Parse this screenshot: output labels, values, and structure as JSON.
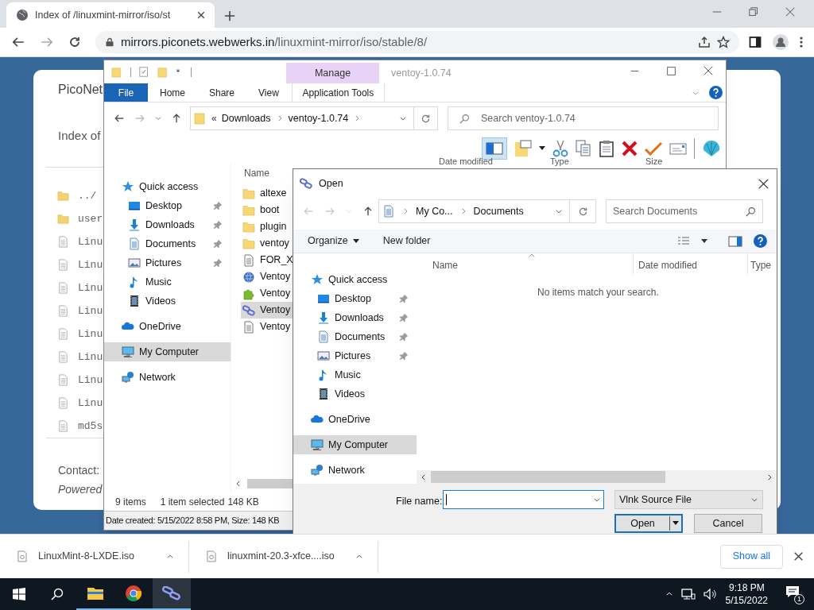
{
  "browser": {
    "tab_title": "Index of /linuxmint-mirror/iso/st",
    "url_host": "mirrors.piconets.webwerks.in",
    "url_path": "/linuxmint-mirror/iso/stable/8/"
  },
  "web_page": {
    "site_name": "PicoNet",
    "heading": "Index of",
    "entries": [
      {
        "name": "../",
        "kind": "folder"
      },
      {
        "name": "user",
        "kind": "folder"
      },
      {
        "name": "Linu",
        "kind": "file"
      },
      {
        "name": "Linu",
        "kind": "file"
      },
      {
        "name": "Linu",
        "kind": "file"
      },
      {
        "name": "Linu",
        "kind": "file"
      },
      {
        "name": "Linu",
        "kind": "file"
      },
      {
        "name": "Linu",
        "kind": "file"
      },
      {
        "name": "Linu",
        "kind": "file"
      },
      {
        "name": "Linu",
        "kind": "file"
      },
      {
        "name": "md5s",
        "kind": "file"
      }
    ],
    "contact": "Contact:",
    "powered": "Powered"
  },
  "explorer": {
    "title": "ventoy-1.0.74",
    "context_tab": "Manage",
    "file_tab": "File",
    "ribbon_tabs": [
      {
        "label": "Home",
        "kind": "tab"
      },
      {
        "label": "Share",
        "kind": "tab"
      },
      {
        "label": "View",
        "kind": "tab"
      },
      {
        "label": "Application Tools",
        "kind": "context"
      }
    ],
    "path_overflow": "«",
    "path": [
      "Downloads",
      "ventoy-1.0.74"
    ],
    "search_placeholder": "Search ventoy-1.0.74",
    "columns": [
      "Name",
      "Date modified",
      "Type",
      "Size"
    ],
    "nav": [
      {
        "label": "Quick access",
        "kind": "quick-access",
        "selected": false,
        "children": [
          {
            "label": "Desktop",
            "kind": "desktop",
            "pinned": true,
            "selected": false
          },
          {
            "label": "Downloads",
            "kind": "downloads",
            "pinned": true,
            "selected": false
          },
          {
            "label": "Documents",
            "kind": "documents",
            "pinned": true,
            "selected": false
          },
          {
            "label": "Pictures",
            "kind": "pictures",
            "pinned": true,
            "selected": false
          },
          {
            "label": "Music",
            "kind": "music",
            "pinned": false,
            "selected": false
          },
          {
            "label": "Videos",
            "kind": "videos",
            "pinned": false,
            "selected": false
          }
        ]
      },
      {
        "label": "OneDrive",
        "kind": "onedrive",
        "selected": false
      },
      {
        "label": "My Computer",
        "kind": "computer",
        "selected": true
      },
      {
        "label": "Network",
        "kind": "network",
        "selected": false
      }
    ],
    "files": [
      {
        "name": "altexe",
        "kind": "folder",
        "selected": false
      },
      {
        "name": "boot",
        "kind": "folder",
        "selected": false
      },
      {
        "name": "plugin",
        "kind": "folder",
        "selected": false
      },
      {
        "name": "ventoy",
        "kind": "folder",
        "selected": false
      },
      {
        "name": "FOR_X",
        "kind": "text",
        "selected": false
      },
      {
        "name": "Ventoy",
        "kind": "globe-app",
        "selected": false
      },
      {
        "name": "Ventoy",
        "kind": "puzzle-app",
        "selected": false
      },
      {
        "name": "Ventoy",
        "kind": "link-app",
        "selected": true
      },
      {
        "name": "Ventoy",
        "kind": "text",
        "selected": false
      }
    ],
    "item_count": "9 items",
    "selection": "1 item selected",
    "selection_size": "148 KB",
    "details": "Date created: 5/15/2022 8:58 PM, Size: 148 KB"
  },
  "open_dialog": {
    "title": "Open",
    "path": [
      "My Co...",
      "Documents"
    ],
    "search_placeholder": "Search Documents",
    "organize": "Organize",
    "new_folder": "New folder",
    "columns": [
      "Name",
      "Date modified",
      "Type"
    ],
    "empty_message": "No items match your search.",
    "nav": [
      {
        "label": "Quick access",
        "kind": "quick-access",
        "selected": false,
        "children": [
          {
            "label": "Desktop",
            "kind": "desktop",
            "pinned": true,
            "selected": false
          },
          {
            "label": "Downloads",
            "kind": "downloads",
            "pinned": true,
            "selected": false
          },
          {
            "label": "Documents",
            "kind": "documents",
            "pinned": true,
            "selected": false
          },
          {
            "label": "Pictures",
            "kind": "pictures",
            "pinned": true,
            "selected": false
          },
          {
            "label": "Music",
            "kind": "music",
            "pinned": false,
            "selected": false
          },
          {
            "label": "Videos",
            "kind": "videos",
            "pinned": false,
            "selected": false
          }
        ]
      },
      {
        "label": "OneDrive",
        "kind": "onedrive",
        "selected": false
      },
      {
        "label": "My Computer",
        "kind": "computer",
        "selected": true
      },
      {
        "label": "Network",
        "kind": "network",
        "selected": false
      }
    ],
    "file_name_label": "File name:",
    "file_type": "Vlnk Source File",
    "buttons": [
      "Open",
      "Cancel"
    ]
  },
  "downloads": [
    "LinuxMint-8-LXDE.iso",
    "linuxmint-20.3-xfce....iso"
  ],
  "show_all": "Show all",
  "taskbar": {
    "apps": [
      {
        "kind": "start",
        "selected": false
      },
      {
        "kind": "search",
        "selected": false
      },
      {
        "kind": "explorer",
        "selected": false
      },
      {
        "kind": "chrome",
        "selected": false
      },
      {
        "kind": "vlnk",
        "selected": true
      }
    ],
    "time": "9:18 PM",
    "date": "5/15/2022",
    "notifications": "1"
  }
}
